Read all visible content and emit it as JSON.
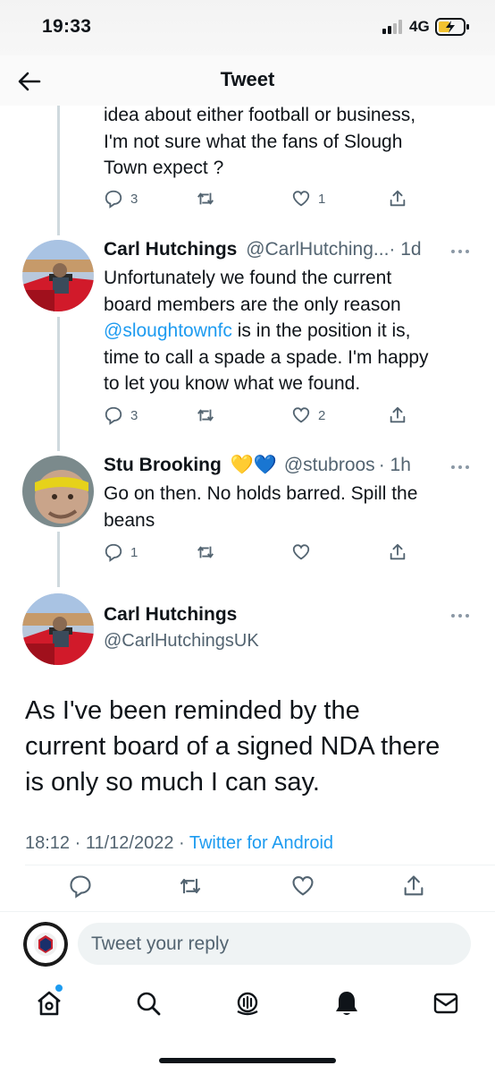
{
  "status_bar": {
    "time": "19:33",
    "network": "4G"
  },
  "header": {
    "title": "Tweet"
  },
  "tweets": [
    {
      "text_lines": [
        "idea about either football or business,",
        "I'm not sure what the fans of Slough",
        "Town expect ?"
      ],
      "replies": "3",
      "retweets": "",
      "likes": "1"
    },
    {
      "name": "Carl Hutchings",
      "handle": "@CarlHutching...",
      "time": "· 1d",
      "text_lines_1": [
        "Unfortunately we found the current",
        "board members are the only reason"
      ],
      "mention": "@sloughtownfc",
      "text_after_mention": " is in the position it is,",
      "text_lines_2": [
        "time to call a spade a spade. I'm happy",
        "to let you know what we found."
      ],
      "replies": "3",
      "retweets": "",
      "likes": "2"
    },
    {
      "name": "Stu Brooking",
      "emoji": "💛💙",
      "handle": "@stubroos",
      "time": "· 1h",
      "text_lines": [
        "Go on then. No holds barred. Spill the",
        "beans"
      ],
      "replies": "1",
      "retweets": "",
      "likes": ""
    }
  ],
  "main_tweet": {
    "name": "Carl Hutchings",
    "handle": "@CarlHutchingsUK",
    "text_lines": [
      "As I've been reminded by the",
      "current board of a signed NDA there",
      "is only so much I can say."
    ],
    "timestamp": "18:12 · 11/12/2022 · ",
    "source": "Twitter for Android"
  },
  "reply_bar": {
    "placeholder": "Tweet your reply"
  },
  "tabs": [
    "home-icon",
    "search-icon",
    "spaces-icon",
    "notifications-icon",
    "messages-icon"
  ],
  "colors": {
    "accent": "#1d9bf0",
    "muted": "#536471",
    "text": "#0f1419"
  }
}
